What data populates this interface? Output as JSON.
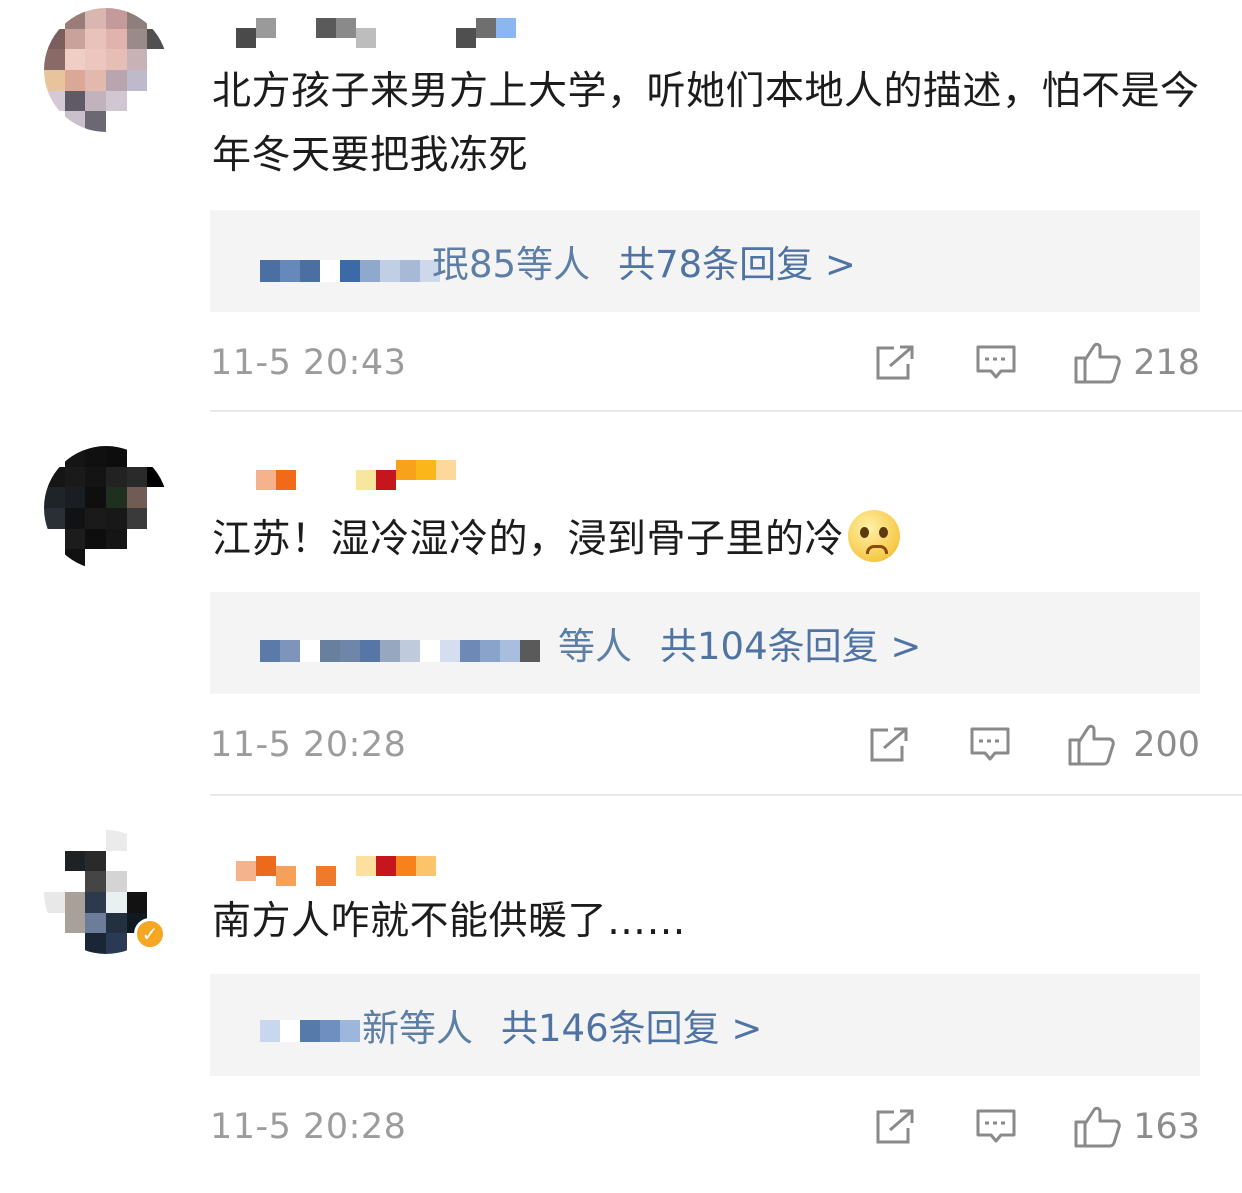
{
  "comments": [
    {
      "text": "北方孩子来男方上大学，听她们本地人的描述，怕不是今年冬天要把我冻死",
      "reply_who": "珉85等人",
      "reply_count": "共78条回复 >",
      "time": "11-5 20:43",
      "likes": "218",
      "emoji": ""
    },
    {
      "text": "江苏！湿冷湿冷的，浸到骨子里的冷",
      "reply_who": "等人",
      "reply_count": "共104条回复 >",
      "time": "11-5 20:28",
      "likes": "200",
      "emoji": "crying-face"
    },
    {
      "text": "南方人咋就不能供暖了……",
      "reply_who": "新等人",
      "reply_count": "共146条回复 >",
      "time": "11-5 20:28",
      "likes": "163",
      "emoji": ""
    }
  ],
  "icons": {
    "share": "share-icon",
    "comment": "comment-icon",
    "like": "like-icon",
    "verified": "verified-badge-icon"
  },
  "colors": {
    "reply_link": "#5d7fa6",
    "reply_bg": "#f4f4f4",
    "meta_gray": "#9c9c9c",
    "verified_badge": "#f5a623"
  }
}
